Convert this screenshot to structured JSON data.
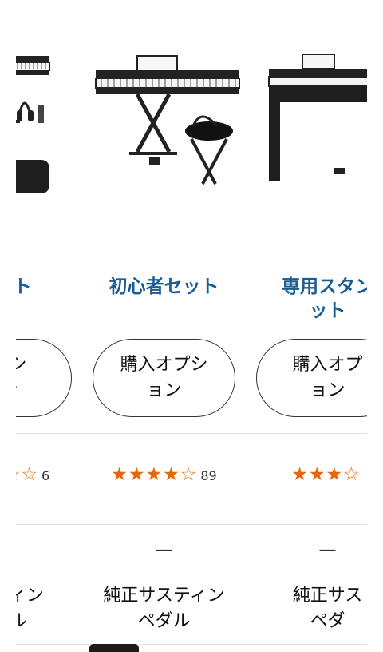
{
  "products": [
    {
      "image": "digital-piano-set-with-headphones",
      "title_lines": [
        "-セット",
        ""
      ],
      "buy_option": [
        "オプシ",
        "ョン"
      ],
      "stars_filled": 2.5,
      "stars_text": "★★⯪☆☆",
      "review_count": "6",
      "dash": "—",
      "feature_lines": [
        "ステティン",
        "ペダル"
      ]
    },
    {
      "image": "digital-piano-beginner-set",
      "title_lines": [
        "初心者セット",
        ""
      ],
      "buy_option": [
        "購入オプシ",
        "ョン"
      ],
      "stars_filled": 4,
      "stars_text": "★★★★☆",
      "review_count": "89",
      "dash": "—",
      "feature_lines": [
        "純正サスティン",
        "ペダル"
      ]
    },
    {
      "image": "digital-piano-stand-set",
      "title_lines": [
        "専用スタン",
        "ット"
      ],
      "buy_option": [
        "購入オプ",
        "ョン"
      ],
      "stars_filled": 3,
      "stars_text": "★★★☆",
      "review_count": "",
      "dash": "—",
      "feature_lines": [
        "純正サス",
        "ペダ"
      ]
    }
  ]
}
